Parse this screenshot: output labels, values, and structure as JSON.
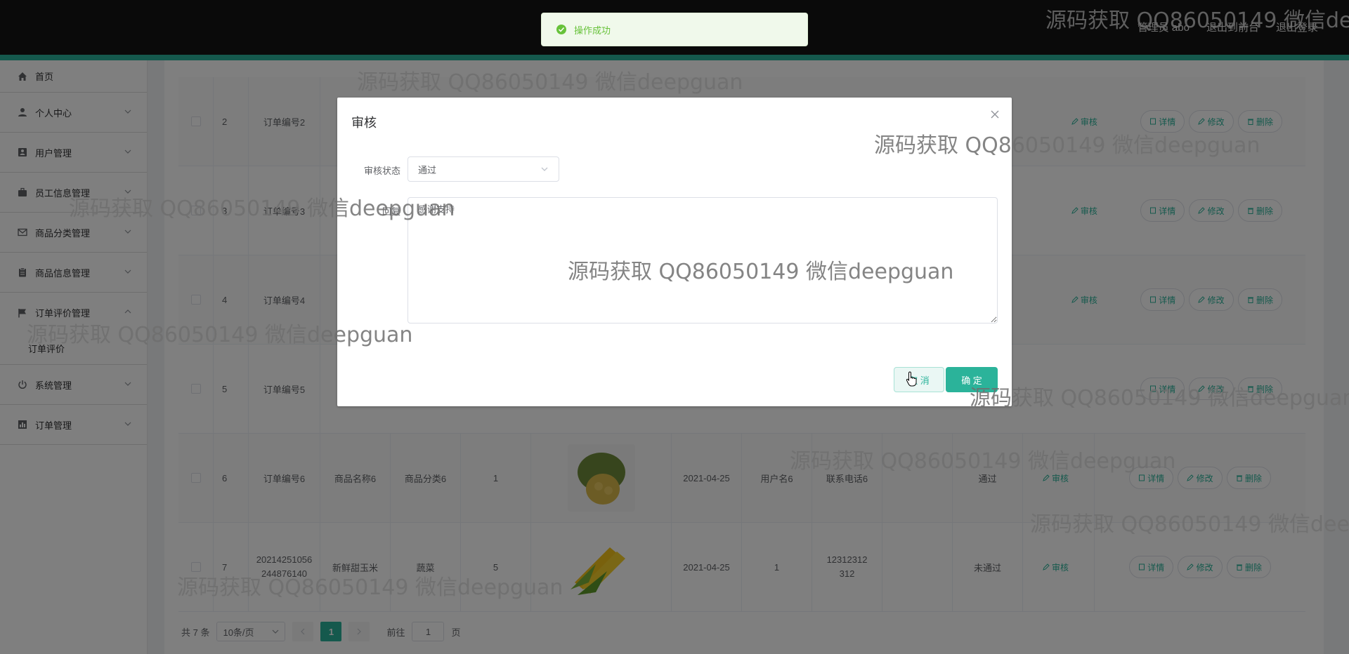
{
  "header": {
    "admin_label": "管理员 abo",
    "front_label": "退出到前台",
    "logout_label": "退出登录"
  },
  "toast": {
    "message": "操作成功"
  },
  "sidebar": {
    "items": [
      {
        "label": "首页",
        "icon": "home-icon"
      },
      {
        "label": "个人中心",
        "icon": "user-icon"
      },
      {
        "label": "用户管理",
        "icon": "user-manage-icon"
      },
      {
        "label": "员工信息管理",
        "icon": "briefcase-icon"
      },
      {
        "label": "商品分类管理",
        "icon": "mail-icon"
      },
      {
        "label": "商品信息管理",
        "icon": "clipboard-icon"
      },
      {
        "label": "订单评价管理",
        "icon": "flag-icon"
      },
      {
        "label": "订单评价",
        "icon": ""
      },
      {
        "label": "系统管理",
        "icon": "power-icon"
      },
      {
        "label": "订单管理",
        "icon": "chart-icon"
      }
    ]
  },
  "table": {
    "rows": [
      {
        "index": "2",
        "order_no": "订单编号2",
        "product": "",
        "category": "",
        "qty": "",
        "date": "",
        "user": "",
        "phone": "",
        "status": ""
      },
      {
        "index": "3",
        "order_no": "订单编号3",
        "product": "",
        "category": "",
        "qty": "",
        "date": "",
        "user": "",
        "phone": "",
        "status": ""
      },
      {
        "index": "4",
        "order_no": "订单编号4",
        "product": "",
        "category": "",
        "qty": "",
        "date": "",
        "user": "",
        "phone": "",
        "status": ""
      },
      {
        "index": "5",
        "order_no": "订单编号5",
        "product": "",
        "category": "",
        "qty": "",
        "date": "",
        "user": "",
        "phone": "",
        "status": ""
      },
      {
        "index": "6",
        "order_no": "订单编号6",
        "product": "商品名称6",
        "category": "商品分类6",
        "qty": "1",
        "date": "2021-04-25",
        "user": "用户名6",
        "phone": "联系电话6",
        "status": "通过"
      },
      {
        "index": "7",
        "order_no": "20214251056244876140",
        "product": "新鲜甜玉米",
        "category": "蔬菜",
        "qty": "5",
        "date": "2021-04-25",
        "user": "1",
        "phone": "12312312312",
        "status": "未通过"
      }
    ],
    "actions": {
      "audit": "审核",
      "detail": "详情",
      "edit": "修改",
      "delete": "删除"
    }
  },
  "pagination": {
    "total": "共 7 条",
    "page_size": "10条/页",
    "current": "1",
    "goto_label": "前往",
    "goto_value": "1",
    "page_unit": "页"
  },
  "dialog": {
    "title": "审核",
    "status_label": "审核状态",
    "status_value": "通过",
    "reply_label": "回复",
    "reply_value": "感谢支持",
    "cancel": "取 消",
    "confirm": "确 定"
  },
  "watermark": {
    "text": "源码获取 QQ86050149 微信deepguan"
  },
  "colors": {
    "accent": "#2bb39a",
    "topbar": "#141414"
  }
}
